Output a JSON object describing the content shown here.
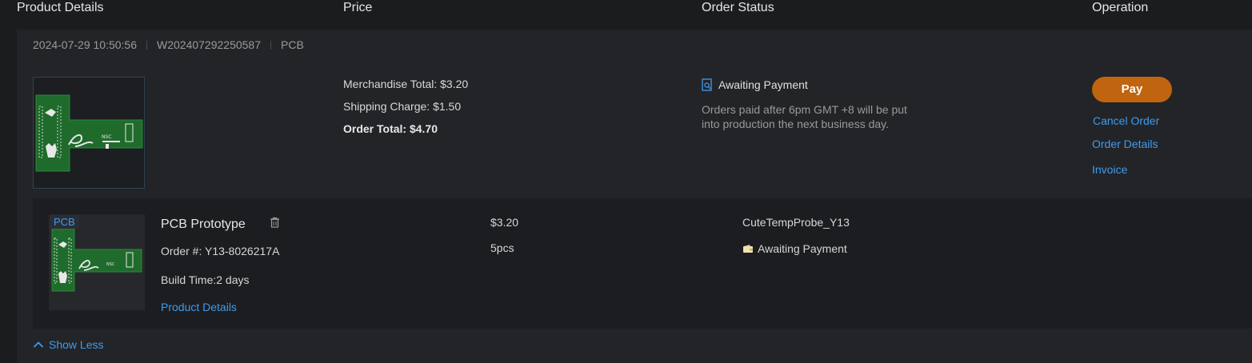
{
  "header": {
    "product_details": "Product Details",
    "price": "Price",
    "order_status": "Order Status",
    "operation": "Operation"
  },
  "order": {
    "datetime": "2024-07-29 10:50:56",
    "order_id": "W202407292250587",
    "category": "PCB",
    "merchandise_total": "Merchandise Total: $3.20",
    "shipping_charge": "Shipping Charge: $1.50",
    "order_total": "Order Total: $4.70",
    "status": "Awaiting Payment",
    "status_note": "Orders paid after 6pm GMT +8 will be put into production the next business day.",
    "actions": {
      "pay": "Pay",
      "cancel": "Cancel Order",
      "details": "Order Details",
      "invoice": "Invoice"
    }
  },
  "item": {
    "badge": "PCB",
    "title": "PCB Prototype",
    "order_number": "Order #: Y13-8026217A",
    "build_time": "Build Time:2 days",
    "product_details_link": "Product Details",
    "price": "$3.20",
    "quantity": "5pcs",
    "file_name": "CuteTempProbe_Y13",
    "status": "Awaiting Payment"
  },
  "footer": {
    "show_less": "Show Less"
  },
  "colors": {
    "accent_link": "#3d9bf0",
    "pay_button": "#c0640f",
    "pcb_green": "#1f6b2c"
  }
}
